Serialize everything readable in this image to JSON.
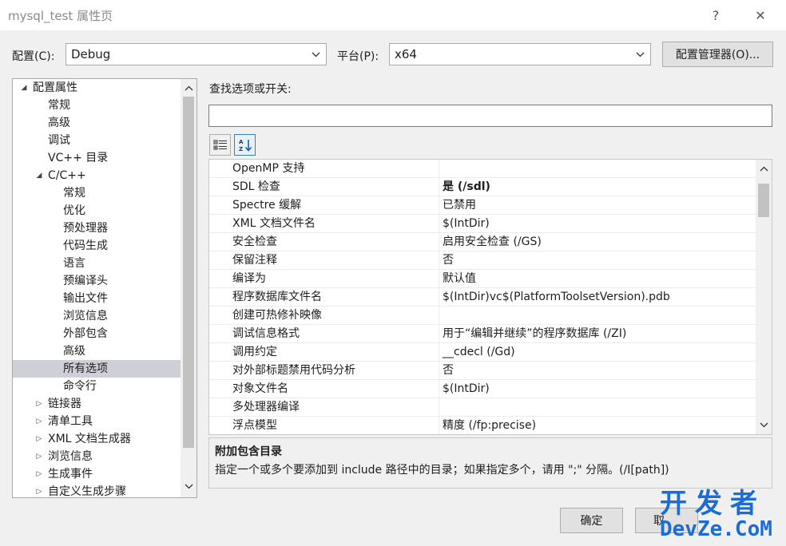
{
  "window": {
    "title": "mysql_test 属性页",
    "help_label": "?",
    "close_label": "✕"
  },
  "config": {
    "config_label": "配置(C):",
    "config_value": "Debug",
    "platform_label": "平台(P):",
    "platform_value": "x64",
    "manager_label": "配置管理器(O)..."
  },
  "tree": {
    "items": [
      {
        "label": "配置属性",
        "expander": "◢"
      },
      {
        "label": "常规",
        "expander": ""
      },
      {
        "label": "高级",
        "expander": ""
      },
      {
        "label": "调试",
        "expander": ""
      },
      {
        "label": "VC++ 目录",
        "expander": ""
      },
      {
        "label": "C/C++",
        "expander": "◢"
      },
      {
        "label": "常规",
        "expander": ""
      },
      {
        "label": "优化",
        "expander": ""
      },
      {
        "label": "预处理器",
        "expander": ""
      },
      {
        "label": "代码生成",
        "expander": ""
      },
      {
        "label": "语言",
        "expander": ""
      },
      {
        "label": "预编译头",
        "expander": ""
      },
      {
        "label": "输出文件",
        "expander": ""
      },
      {
        "label": "浏览信息",
        "expander": ""
      },
      {
        "label": "外部包含",
        "expander": ""
      },
      {
        "label": "高级",
        "expander": ""
      },
      {
        "label": "所有选项",
        "expander": "",
        "selected": true
      },
      {
        "label": "命令行",
        "expander": ""
      },
      {
        "label": "链接器",
        "expander": "▷"
      },
      {
        "label": "清单工具",
        "expander": "▷"
      },
      {
        "label": "XML 文档生成器",
        "expander": "▷"
      },
      {
        "label": "浏览信息",
        "expander": "▷"
      },
      {
        "label": "生成事件",
        "expander": "▷"
      },
      {
        "label": "自定义生成步骤",
        "expander": "▷"
      }
    ]
  },
  "search": {
    "label": "查找选项或开关:",
    "value": ""
  },
  "grid": {
    "rows": [
      {
        "name": "OpenMP 支持",
        "value": ""
      },
      {
        "name": "SDL 检查",
        "value": "是 (/sdl)",
        "bold": true
      },
      {
        "name": "Spectre 缓解",
        "value": "已禁用"
      },
      {
        "name": "XML 文档文件名",
        "value": "$(IntDir)"
      },
      {
        "name": "安全检查",
        "value": "启用安全检查 (/GS)"
      },
      {
        "name": "保留注释",
        "value": "否"
      },
      {
        "name": "编译为",
        "value": "默认值"
      },
      {
        "name": "程序数据库文件名",
        "value": "$(IntDir)vc$(PlatformToolsetVersion).pdb"
      },
      {
        "name": "创建可热修补映像",
        "value": ""
      },
      {
        "name": "调试信息格式",
        "value": "用于“编辑并继续”的程序数据库 (/ZI)"
      },
      {
        "name": "调用约定",
        "value": "__cdecl (/Gd)"
      },
      {
        "name": "对外部标题禁用代码分析",
        "value": "否"
      },
      {
        "name": "对象文件名",
        "value": "$(IntDir)"
      },
      {
        "name": "多处理器编译",
        "value": ""
      },
      {
        "name": "浮点模型",
        "value": "精度 (/fp:precise)"
      }
    ]
  },
  "description": {
    "title": "附加包含目录",
    "text": "指定一个或多个要添加到 include 路径中的目录；如果指定多个，请用 \";\" 分隔。(/I[path])"
  },
  "footer": {
    "ok_label": "确定",
    "cancel_label": "取"
  },
  "watermark": {
    "line1": "开发者",
    "line2": "DevZe.CoM"
  },
  "colors": {
    "selection": "#cfcfd8",
    "watermark": "#1a6cd6",
    "active_tool_border": "#3c7fb1"
  }
}
